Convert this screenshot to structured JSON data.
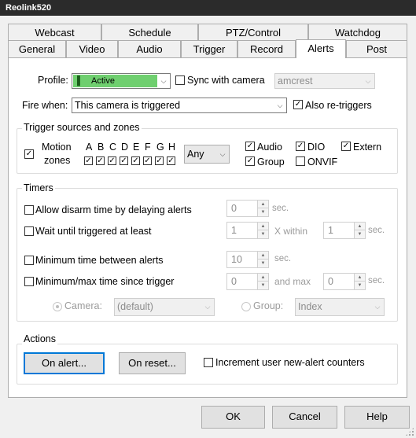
{
  "window": {
    "title": "Reolink520"
  },
  "tabs": {
    "row1": [
      "Webcast",
      "Schedule",
      "PTZ/Control",
      "Watchdog"
    ],
    "row2": [
      "General",
      "Video",
      "Audio",
      "Trigger",
      "Record",
      "Alerts",
      "Post"
    ],
    "active": "Alerts"
  },
  "profile": {
    "label": "Profile:",
    "value": "Active",
    "color": "#6fcf6f",
    "sync_label": "Sync with camera",
    "sync_checked": false,
    "sync_camera": "amcrest"
  },
  "fire_when": {
    "label": "Fire when:",
    "value": "This camera is triggered",
    "also_retriggers_label": "Also re-triggers",
    "also_retriggers_checked": true
  },
  "trigger_sources": {
    "title": "Trigger sources and zones",
    "motion_label_1": "Motion",
    "motion_label_2": "zones",
    "motion_checked": true,
    "zones": [
      {
        "letter": "A",
        "checked": true
      },
      {
        "letter": "B",
        "checked": true
      },
      {
        "letter": "C",
        "checked": true
      },
      {
        "letter": "D",
        "checked": true
      },
      {
        "letter": "E",
        "checked": true
      },
      {
        "letter": "F",
        "checked": true
      },
      {
        "letter": "G",
        "checked": true
      },
      {
        "letter": "H",
        "checked": true
      }
    ],
    "zone_mode": "Any",
    "audio": {
      "label": "Audio",
      "checked": true
    },
    "dio": {
      "label": "DIO",
      "checked": true
    },
    "extern": {
      "label": "Extern",
      "checked": true
    },
    "group": {
      "label": "Group",
      "checked": true
    },
    "onvif": {
      "label": "ONVIF",
      "checked": false
    }
  },
  "timers": {
    "title": "Timers",
    "allow_disarm": {
      "label": "Allow disarm time by delaying alerts",
      "value": "0",
      "unit": "sec."
    },
    "wait_until": {
      "label": "Wait until triggered at least",
      "value": "1",
      "mid": "X within",
      "value2": "1",
      "unit": "sec."
    },
    "min_between": {
      "label": "Minimum time between alerts",
      "value": "10",
      "unit": "sec."
    },
    "min_max": {
      "label": "Minimum/max time since trigger",
      "value": "0",
      "mid": "and max",
      "value2": "0",
      "unit": "sec."
    },
    "camera_label": "Camera:",
    "camera_value": "(default)",
    "group_label": "Group:",
    "group_value": "Index"
  },
  "actions": {
    "title": "Actions",
    "on_alert": "On alert...",
    "on_reset": "On reset...",
    "increment_label": "Increment user new-alert counters",
    "increment_checked": false
  },
  "footer": {
    "ok": "OK",
    "cancel": "Cancel",
    "help": "Help"
  }
}
